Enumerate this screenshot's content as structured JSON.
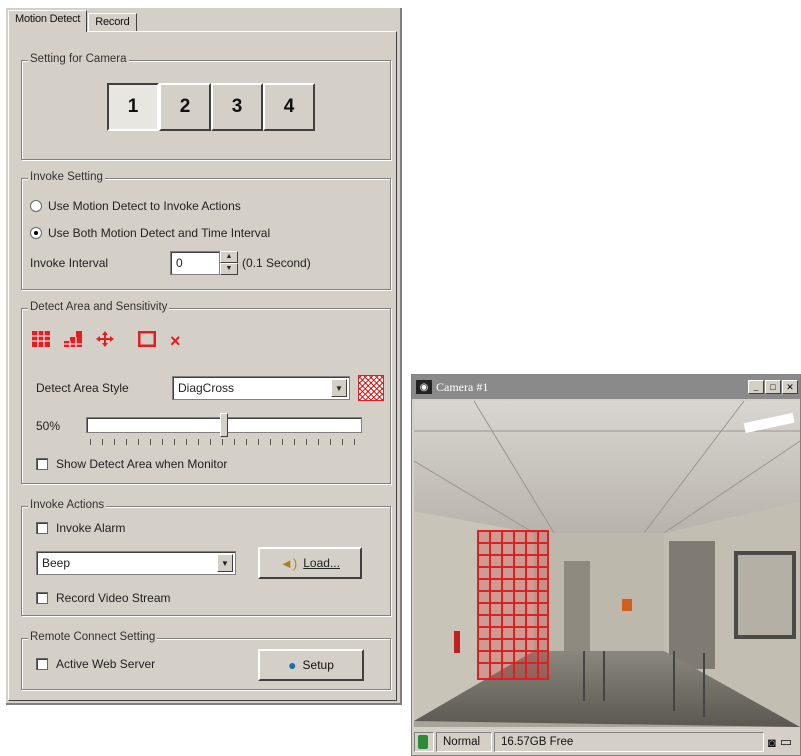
{
  "tabs": [
    "Motion Detect",
    "Record"
  ],
  "camera_group": {
    "title": "Setting for Camera",
    "buttons": [
      "1",
      "2",
      "3",
      "4"
    ],
    "selected": "1"
  },
  "invoke_setting": {
    "title": "Invoke Setting",
    "option1": "Use Motion Detect to Invoke Actions",
    "option2": "Use Both Motion Detect and Time Interval",
    "selected_option": 2,
    "interval_label": "Invoke Interval",
    "interval_value": "0",
    "interval_unit": "(0.1 Second)"
  },
  "detect_area": {
    "title": "Detect Area and Sensitivity",
    "tool_icons": [
      "grid-select-icon",
      "area-step-icon",
      "move-icon",
      "rectangle-icon",
      "delete-icon"
    ],
    "style_label": "Detect Area Style",
    "style_value": "DiagCross",
    "sensitivity_label": "50%",
    "sensitivity": 0.5,
    "show_label": "Show Detect Area when Monitor"
  },
  "invoke_actions": {
    "title": "Invoke Actions",
    "alarm_label": "Invoke Alarm",
    "sound_value": "Beep",
    "load_label": "Load...",
    "record_label": "Record Video Stream"
  },
  "remote": {
    "title": "Remote Connect Setting",
    "web_label": "Active Web Server",
    "setup_label": "Setup"
  },
  "camera_window": {
    "title": "Camera #1",
    "status_mode": "Normal",
    "status_free": "16.57GB Free"
  },
  "colors": {
    "accent_red": "#e02020",
    "panel_bg": "#d4d0c8",
    "title_bar": "#8a8a8a"
  }
}
